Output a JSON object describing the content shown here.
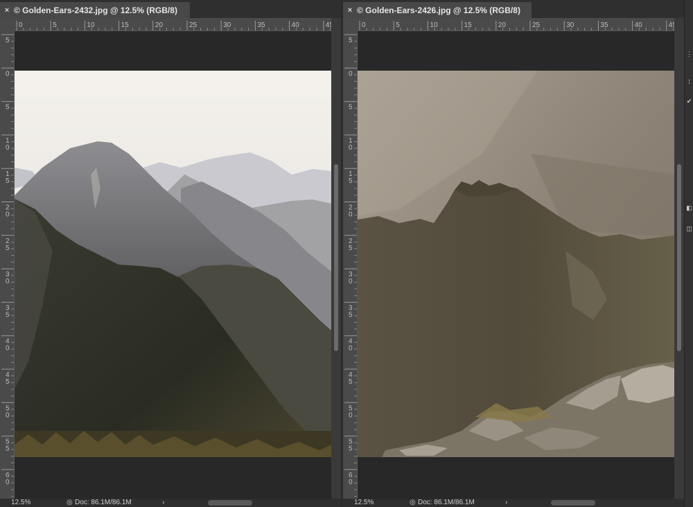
{
  "documents": [
    {
      "tab_title": "© Golden-Ears-2432.jpg @ 12.5% (RGB/8)",
      "close_glyph": "×",
      "ruler_top_labels": [
        "0",
        "5",
        "10",
        "15",
        "20",
        "25",
        "30",
        "35",
        "40",
        "45"
      ],
      "ruler_left_labels": [
        "5",
        "0",
        "5",
        "10",
        "15",
        "20",
        "25",
        "30",
        "35",
        "40",
        "45",
        "50",
        "55",
        "60"
      ],
      "zoom": "12.5%",
      "doc_size": "Doc: 86.1M/86.1M",
      "status_arrow": "›"
    },
    {
      "tab_title": "© Golden-Ears-2426.jpg @ 12.5% (RGB/8)",
      "close_glyph": "×",
      "ruler_top_labels": [
        "0",
        "5",
        "10",
        "15",
        "20",
        "25",
        "30",
        "35",
        "40",
        "45"
      ],
      "ruler_left_labels": [
        "5",
        "0",
        "5",
        "10",
        "15",
        "20",
        "25",
        "30",
        "35",
        "40",
        "45",
        "50",
        "55",
        "60"
      ],
      "zoom": "12.5%",
      "doc_size": "Doc: 86.1M/86.1M",
      "status_arrow": "›"
    }
  ],
  "side_panel": {
    "icons": [
      "panel-options-icon",
      "brush-icon",
      "settings-icon",
      "layers-icon",
      "channels-icon"
    ]
  }
}
